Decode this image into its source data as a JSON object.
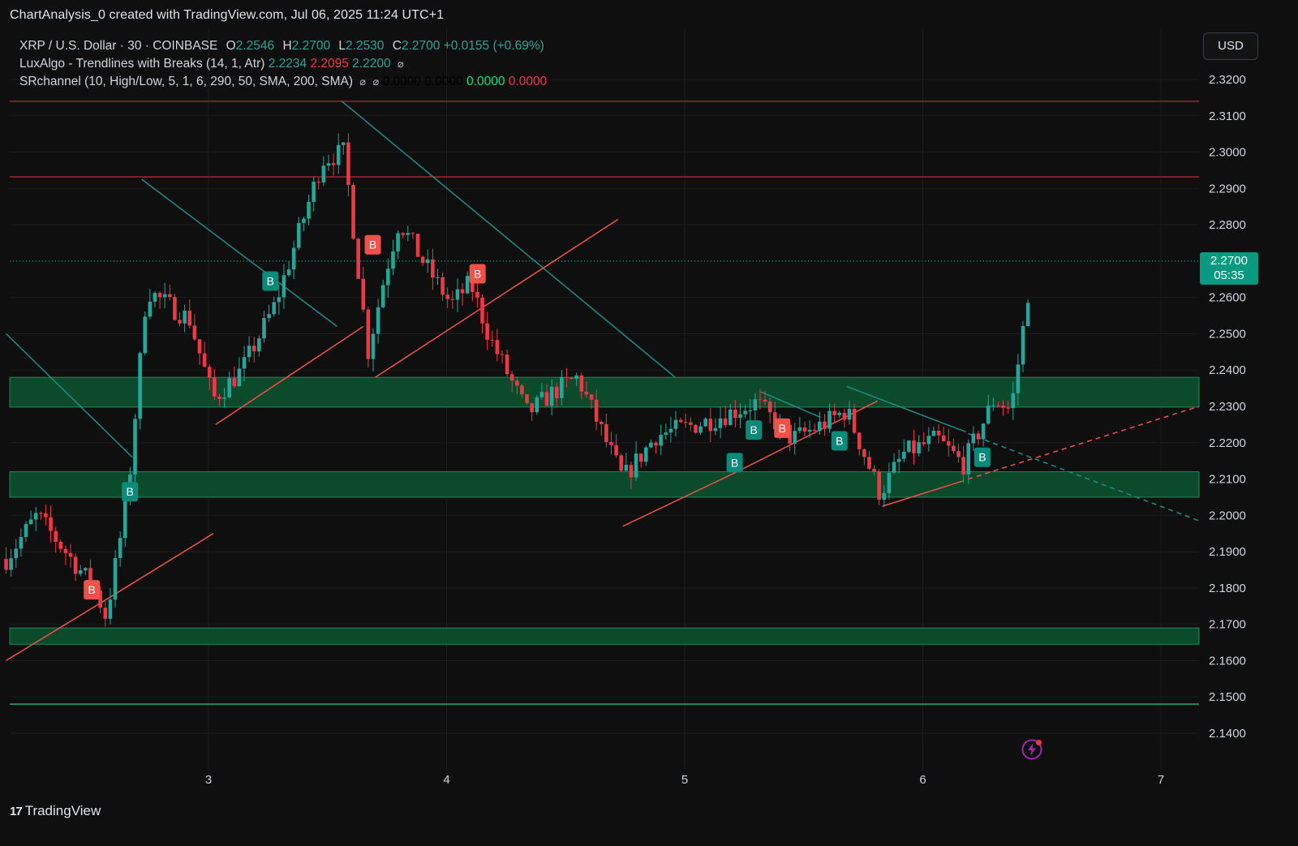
{
  "header": {
    "caption": "ChartAnalysis_0 created with TradingView.com, Jul 06, 2025 11:24 UTC+1"
  },
  "legend": {
    "symbol": "XRP / U.S. Dollar · 30 · COINBASE",
    "o_label": "O",
    "o": "2.2546",
    "h_label": "H",
    "h": "2.2700",
    "l_label": "L",
    "l": "2.2530",
    "c_label": "C",
    "c": "2.2700",
    "change": "+0.0155 (+0.69%)",
    "ind1_name": "LuxAlgo - Trendlines with Breaks (14, 1, Atr)",
    "ind1_v1": "2.2234",
    "ind1_v2": "2.2095",
    "ind1_v3": "2.2200",
    "ind2_name": "SRchannel (10, High/Low, 5, 1, 6, 290, 50, SMA, 200, SMA)",
    "ind2_v1": "0.0000",
    "ind2_v2": "0.0000",
    "ind2_v3": "0.0000",
    "ind2_v4": "0.0000",
    "eye_icon": "⌀"
  },
  "currency_button": "USD",
  "price_tag": {
    "price": "2.2700",
    "countdown": "05:35"
  },
  "footer": {
    "brand": "TradingView",
    "logo_text": "17"
  },
  "colors": {
    "bull": "#26a69a",
    "bear": "#f23645",
    "zone_fill": "#0b4a2b",
    "zone_border": "#1f8a5a",
    "resistance": "#7a2228",
    "support_line": "#1f8a5a",
    "trend_down": "#1b8f86",
    "trend_up": "#f0524a"
  },
  "chart_data": {
    "type": "candlestick",
    "title": "XRP / U.S. Dollar · 30 · COINBASE",
    "x_ticks": [
      {
        "label": "3",
        "x": 3
      },
      {
        "label": "4",
        "x": 4
      },
      {
        "label": "5",
        "x": 5
      },
      {
        "label": "6",
        "x": 6
      },
      {
        "label": "7",
        "x": 7
      }
    ],
    "xlim": [
      2.15,
      7.16
    ],
    "ylim": [
      2.133,
      2.3255
    ],
    "y_ticks": [
      "2.3200",
      "2.3100",
      "2.3000",
      "2.2900",
      "2.2800",
      "2.2700",
      "2.2600",
      "2.2500",
      "2.2400",
      "2.2300",
      "2.2200",
      "2.2100",
      "2.2000",
      "2.1900",
      "2.1800",
      "2.1700",
      "2.1600",
      "2.1500",
      "2.1400"
    ],
    "last_price": 2.27,
    "sr_zones": [
      {
        "low": 2.2298,
        "high": 2.238
      },
      {
        "low": 2.205,
        "high": 2.212
      },
      {
        "low": 2.1645,
        "high": 2.169
      }
    ],
    "resistance_lines": [
      2.314,
      2.2932
    ],
    "support_lines": [
      2.148
    ],
    "anchors": [
      {
        "x": 2.15,
        "p": 2.188
      },
      {
        "x": 2.28,
        "p": 2.2
      },
      {
        "x": 2.52,
        "p": 2.18
      },
      {
        "x": 2.57,
        "p": 2.172
      },
      {
        "x": 2.66,
        "p": 2.205
      },
      {
        "x": 2.74,
        "p": 2.262
      },
      {
        "x": 2.92,
        "p": 2.254
      },
      {
        "x": 3.02,
        "p": 2.232
      },
      {
        "x": 3.14,
        "p": 2.24
      },
      {
        "x": 3.28,
        "p": 2.258
      },
      {
        "x": 3.48,
        "p": 2.298
      },
      {
        "x": 3.57,
        "p": 2.3
      },
      {
        "x": 3.67,
        "p": 2.245
      },
      {
        "x": 3.74,
        "p": 2.266
      },
      {
        "x": 3.8,
        "p": 2.281
      },
      {
        "x": 3.9,
        "p": 2.27
      },
      {
        "x": 4.02,
        "p": 2.258
      },
      {
        "x": 4.1,
        "p": 2.264
      },
      {
        "x": 4.18,
        "p": 2.249
      },
      {
        "x": 4.34,
        "p": 2.228
      },
      {
        "x": 4.45,
        "p": 2.234
      },
      {
        "x": 4.55,
        "p": 2.238
      },
      {
        "x": 4.74,
        "p": 2.21
      },
      {
        "x": 4.88,
        "p": 2.222
      },
      {
        "x": 5.1,
        "p": 2.226
      },
      {
        "x": 5.3,
        "p": 2.231
      },
      {
        "x": 5.45,
        "p": 2.221
      },
      {
        "x": 5.58,
        "p": 2.225
      },
      {
        "x": 5.68,
        "p": 2.229
      },
      {
        "x": 5.82,
        "p": 2.206
      },
      {
        "x": 5.92,
        "p": 2.217
      },
      {
        "x": 6.06,
        "p": 2.221
      },
      {
        "x": 6.17,
        "p": 2.214
      },
      {
        "x": 6.3,
        "p": 2.232
      },
      {
        "x": 6.37,
        "p": 2.229
      },
      {
        "x": 6.41,
        "p": 2.246
      },
      {
        "x": 6.46,
        "p": 2.27
      }
    ],
    "trendlines_down": [
      [
        [
          2.15,
          2.25
        ],
        [
          2.68,
          2.216
        ]
      ],
      [
        [
          2.72,
          2.2925
        ],
        [
          3.54,
          2.252
        ]
      ],
      [
        [
          3.56,
          2.314
        ],
        [
          4.96,
          2.238
        ]
      ],
      [
        [
          5.32,
          2.234
        ],
        [
          5.57,
          2.227
        ]
      ],
      [
        [
          5.68,
          2.2355
        ],
        [
          6.18,
          2.223
        ]
      ]
    ],
    "trendlines_up": [
      [
        [
          2.15,
          2.16
        ],
        [
          2.6,
          2.178
        ],
        [
          3.02,
          2.195
        ]
      ],
      [
        [
          3.03,
          2.225
        ],
        [
          3.65,
          2.252
        ]
      ],
      [
        [
          3.7,
          2.238
        ],
        [
          4.72,
          2.2815
        ]
      ],
      [
        [
          4.74,
          2.197
        ],
        [
          5.22,
          2.212
        ],
        [
          5.81,
          2.2315
        ]
      ],
      [
        [
          5.83,
          2.2025
        ],
        [
          6.17,
          2.2095
        ]
      ]
    ],
    "trendlines_projection_up": [
      [
        6.19,
        2.21
      ],
      [
        7.16,
        2.23
      ]
    ],
    "trendlines_projection_down": [
      [
        6.19,
        2.2225
      ],
      [
        7.16,
        2.1985
      ]
    ],
    "signals": [
      {
        "type": "B",
        "kind": "bull",
        "x": 2.67,
        "p": 2.2065
      },
      {
        "type": "B",
        "kind": "bear",
        "x": 2.51,
        "p": 2.1795
      },
      {
        "type": "B",
        "kind": "bull",
        "x": 3.26,
        "p": 2.2645
      },
      {
        "type": "B",
        "kind": "bear",
        "x": 3.69,
        "p": 2.2745
      },
      {
        "type": "B",
        "kind": "bear",
        "x": 4.13,
        "p": 2.2665
      },
      {
        "type": "B",
        "kind": "bull",
        "x": 5.21,
        "p": 2.2145
      },
      {
        "type": "B",
        "kind": "bull",
        "x": 5.29,
        "p": 2.2235
      },
      {
        "type": "B",
        "kind": "bear",
        "x": 5.41,
        "p": 2.224
      },
      {
        "type": "B",
        "kind": "bull",
        "x": 5.65,
        "p": 2.2205
      },
      {
        "type": "B",
        "kind": "bull",
        "x": 6.25,
        "p": 2.216
      }
    ]
  }
}
